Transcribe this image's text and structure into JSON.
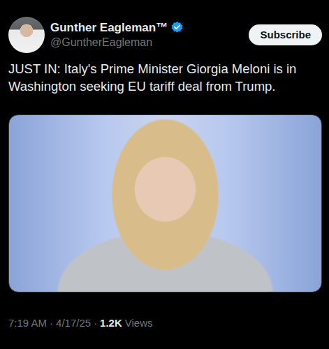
{
  "author": {
    "name": "Gunther Eagleman™",
    "handle": "@GuntherEagleman",
    "verified": true
  },
  "subscribe_button": "Subscribe",
  "tweet": {
    "text": "JUST IN: Italy's Prime Minister Giorgia Meloni is in Washington seeking EU tariff deal from Trump."
  },
  "meta": {
    "time": "7:19 AM",
    "separator": "·",
    "date": "4/17/25",
    "views": "1.2K",
    "views_label": "Views"
  }
}
